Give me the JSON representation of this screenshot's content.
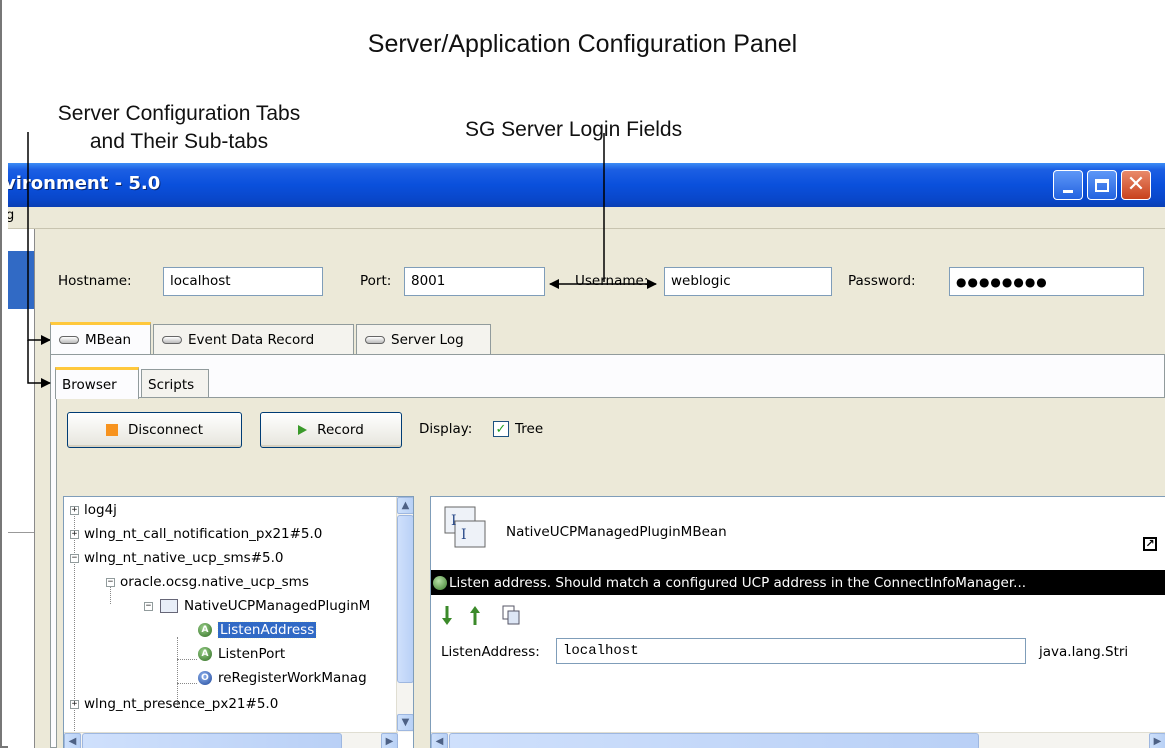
{
  "annotations": {
    "title": "Server/Application Configuration Panel",
    "tabs_note_line1": "Server Configuration Tabs",
    "tabs_note_line2": "and Their Sub-tabs",
    "login_note": "SG Server Login Fields"
  },
  "window": {
    "title_fragment": "vironment - 5.0",
    "menu_fragment": "g"
  },
  "login": {
    "hostname_label": "Hostname:",
    "hostname_value": "localhost",
    "port_label": "Port:",
    "port_value": "8001",
    "username_label": "Username:",
    "username_value": "weblogic",
    "password_label": "Password:",
    "password_mask": "●●●●●●●●"
  },
  "tabs": [
    {
      "label": "MBean",
      "active": true
    },
    {
      "label": "Event Data Record",
      "active": false
    },
    {
      "label": "Server Log",
      "active": false
    }
  ],
  "subtabs": [
    {
      "label": "Browser",
      "active": true
    },
    {
      "label": "Scripts",
      "active": false
    }
  ],
  "toolbar": {
    "disconnect_label": "Disconnect",
    "record_label": "Record",
    "display_label": "Display:",
    "tree_label": "Tree",
    "tree_checked": true
  },
  "tree": {
    "items": [
      {
        "label": "log4j"
      },
      {
        "label": "wlng_nt_call_notification_px21#5.0"
      },
      {
        "label": "wlng_nt_native_ucp_sms#5.0"
      },
      {
        "label": "oracle.ocsg.native_ucp_sms"
      },
      {
        "label": "NativeUCPManagedPluginM"
      },
      {
        "label": "ListenAddress",
        "selected": true
      },
      {
        "label": "ListenPort"
      },
      {
        "label": "reRegisterWorkManag"
      },
      {
        "label": "wlng_nt_presence_px21#5.0"
      }
    ]
  },
  "detail": {
    "mbean_name": "NativeUCPManagedPluginMBean",
    "info_text": "Listen address. Should match a configured UCP address in the ConnectInfoManager...",
    "attr_label": "ListenAddress:",
    "attr_value": "localhost",
    "attr_type": "java.lang.Stri"
  },
  "colors": {
    "titlebar": "#0a50dc",
    "selection": "#316ac5",
    "active_tab_accent": "#ffc83c"
  }
}
